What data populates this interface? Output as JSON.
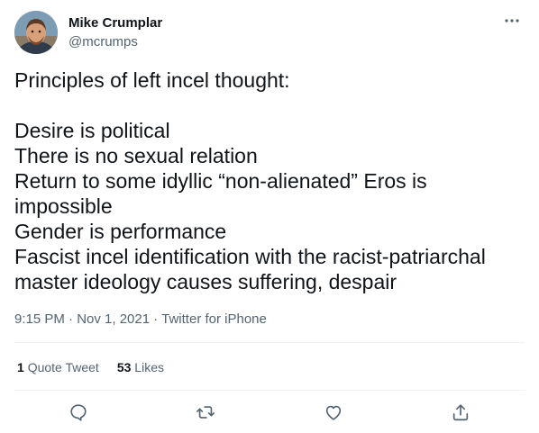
{
  "author": {
    "display_name": "Mike Crumplar",
    "handle": "@mcrumps"
  },
  "tweet": {
    "text": "Principles of left incel thought:\n\nDesire is political\nThere is no sexual relation\nReturn to some idyllic “non-alienated” Eros is impossible\nGender is performance\nFascist incel identification with the racist-patriarchal master ideology causes suffering, despair",
    "meta": "9:15 PM · Nov 1, 2021 · Twitter for iPhone"
  },
  "stats": {
    "quote_count": "1",
    "quote_label": "Quote Tweet",
    "like_count": "53",
    "like_label": "Likes"
  },
  "icons": {
    "more": "more-horizontal-icon",
    "reply": "reply-icon",
    "retweet": "retweet-icon",
    "like": "heart-icon",
    "share": "share-icon"
  },
  "colors": {
    "text": "#0f1419",
    "secondary": "#536471",
    "divider": "#eff3f4"
  }
}
